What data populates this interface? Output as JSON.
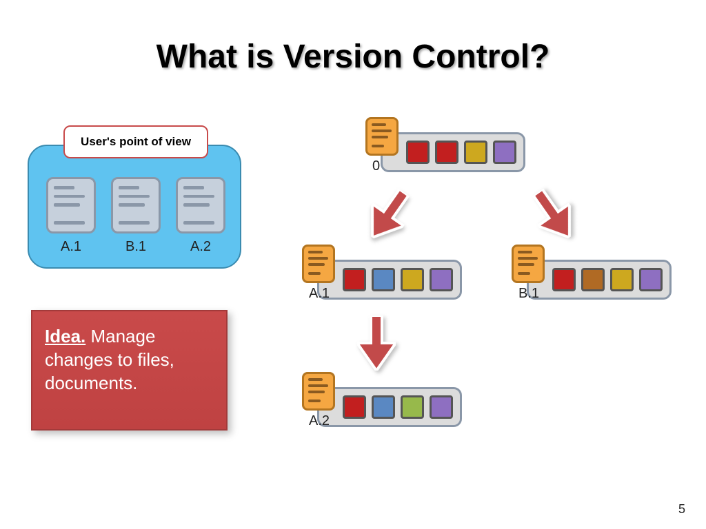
{
  "title": "What is Version Control?",
  "page_number": "5",
  "pov": {
    "label": "User's point of view",
    "docs": [
      "A.1",
      "B.1",
      "A.2"
    ]
  },
  "idea": {
    "prefix": "Idea.",
    "text": " Manage changes to files, documents."
  },
  "nodes": {
    "root": {
      "label": "0",
      "colors": [
        "red",
        "red",
        "gold",
        "purple"
      ]
    },
    "a1": {
      "label": "A.1",
      "colors": [
        "red",
        "blue",
        "gold",
        "purple"
      ]
    },
    "b1": {
      "label": "B.1",
      "colors": [
        "red",
        "brown",
        "gold",
        "purple"
      ]
    },
    "a2": {
      "label": "A.2",
      "colors": [
        "red",
        "blue",
        "green",
        "purple"
      ]
    }
  }
}
